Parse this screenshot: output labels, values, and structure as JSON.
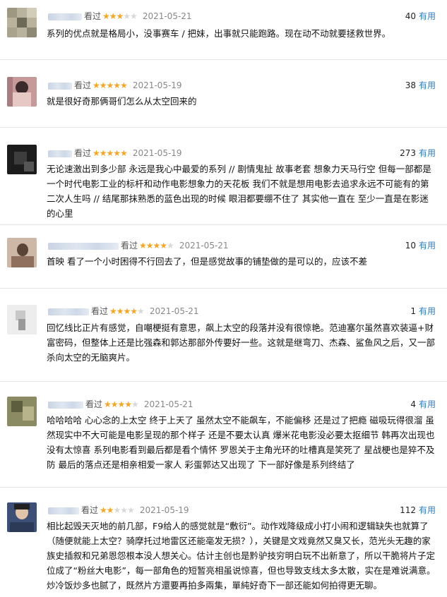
{
  "reviews": [
    {
      "seen_label": "看过",
      "stars": 3,
      "date": "2021-05-21",
      "useful_count": "40",
      "useful_label": "有用",
      "text": "系列的优点就是格局小，没事赛车 / 把妹，出事就只能跑路。现在动不动就要拯救世界。"
    },
    {
      "seen_label": "看过",
      "stars": 5,
      "date": "2021-05-19",
      "useful_count": "38",
      "useful_label": "有用",
      "text": "就是很好奇那俩哥们怎么从太空回来的"
    },
    {
      "seen_label": "看过",
      "stars": 5,
      "date": "2021-05-19",
      "useful_count": "273",
      "useful_label": "有用",
      "text": "无论速激出到多少部 永远是我心中最爱的系列 // 剧情鬼扯 故事老套 想象力天马行空 但每一部都是一个时代电影工业的标杆和动作电影想象力的天花板 我们不就是想用电影去追求永远不可能有的第二次人生吗 // 结尾那抹熟悉的蓝色出现的时候 眼泪都要绷不住了 其实他一直在 至少一直是在影迷的心里"
    },
    {
      "seen_label": "看过",
      "stars": 4,
      "date": "2021-05-21",
      "useful_count": "10",
      "useful_label": "有用",
      "text": "首映 看了一个小时困得不行回去了，但是感觉故事的铺垫做的是可以的，应该不差"
    },
    {
      "seen_label": "看过",
      "stars": 4,
      "date": "2021-05-21",
      "useful_count": "1",
      "useful_label": "有用",
      "text": "回忆线比正片有感觉，自嘲梗挺有意思，飙上太空的段落并没有很惊艳。范迪塞尔虽然喜欢装逼+财富密码，但整体上还是比强森和郭达那部外传要好一些。这就是继弯刀、杰森、鲨鱼风之后，又一部杀向太空的无脑爽片。"
    },
    {
      "seen_label": "看过",
      "stars": 4,
      "date": "2021-05-21",
      "useful_count": "4",
      "useful_label": "有用",
      "text": "哈哈哈哈 心心念的上太空 终于上天了 虽然太空不能飙车，不能偏移 还是过了把瘾 磁吸玩得很溜 虽然现实中不大可能是电影呈现的那个样子 还是不要太认真 爆米花电影没必要太抠细节 韩再次出现也没有太惊喜 系列电影看到最后都是看个情怀 罗恩关于主角光环的吐槽真是笑死了 星战梗也是猝不及防 最后的落点还是相亲相爱一家人 彩蛋郭达又出现了 下一部好像是系列终结了"
    },
    {
      "seen_label": "看过",
      "stars": 2,
      "date": "2021-05-19",
      "useful_count": "112",
      "useful_label": "有用",
      "text": "相比起毁天灭地的前几部，F9给人的感觉就是“敷衍”。动作戏降级成小打小闹和逻辑缺失也就算了（随便就能上太空？骑摩托过地雷区还能毫发无损？），关键是文戏竟然又臭又长，范光头无趣的家族史插叙和兄弟恩怨根本没人想关心。估计主创也是黔驴技穷明白玩不出新意了，所以干脆将片子定位成了“粉丝大电影”，每一部角色的短暂亮相虽说惊喜，但也导致支线太多太散，实在是难说满意。炒冷饭炒多也腻了，既然片方還要再拍多兩集，單純好奇下一部还能如何拍得更无聊。"
    }
  ]
}
